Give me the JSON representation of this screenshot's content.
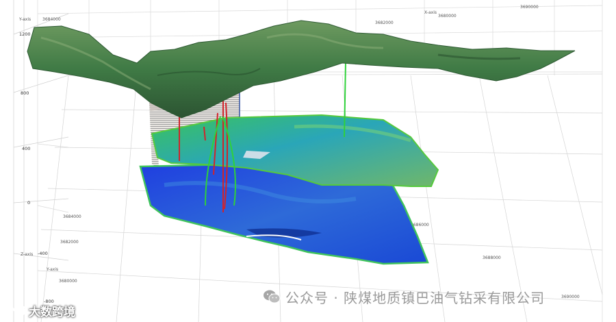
{
  "axes": {
    "y_axis_label": "Y-axis",
    "x_axis_label": "X-axis",
    "z_axis_label": "Z-axis",
    "z_ticks": [
      "1200",
      "800",
      "400",
      "0",
      "-400",
      "-800"
    ],
    "y_ticks_top": [
      "3684000",
      "3682000",
      "3680000"
    ],
    "x_ticks_top": [
      "3690000"
    ],
    "y_ticks_left": [
      "3684000",
      "3682000",
      "3680000"
    ],
    "x_ticks_bottom": [
      "3686000",
      "3688000",
      "3690000"
    ]
  },
  "watermark": {
    "text": "公众号 · 陕煤地质镇巴油气钻采有限公司",
    "icon": "wechat-icon"
  },
  "brand": {
    "text": "大数跨境",
    "icon": "brand-logo-icon"
  },
  "colors": {
    "terrain": "#3f7a45",
    "horizon_upper": "#2fa8b0",
    "horizon_lower": "#1b4fe0",
    "well_red": "#d2232a",
    "well_green": "#2fd13a"
  }
}
